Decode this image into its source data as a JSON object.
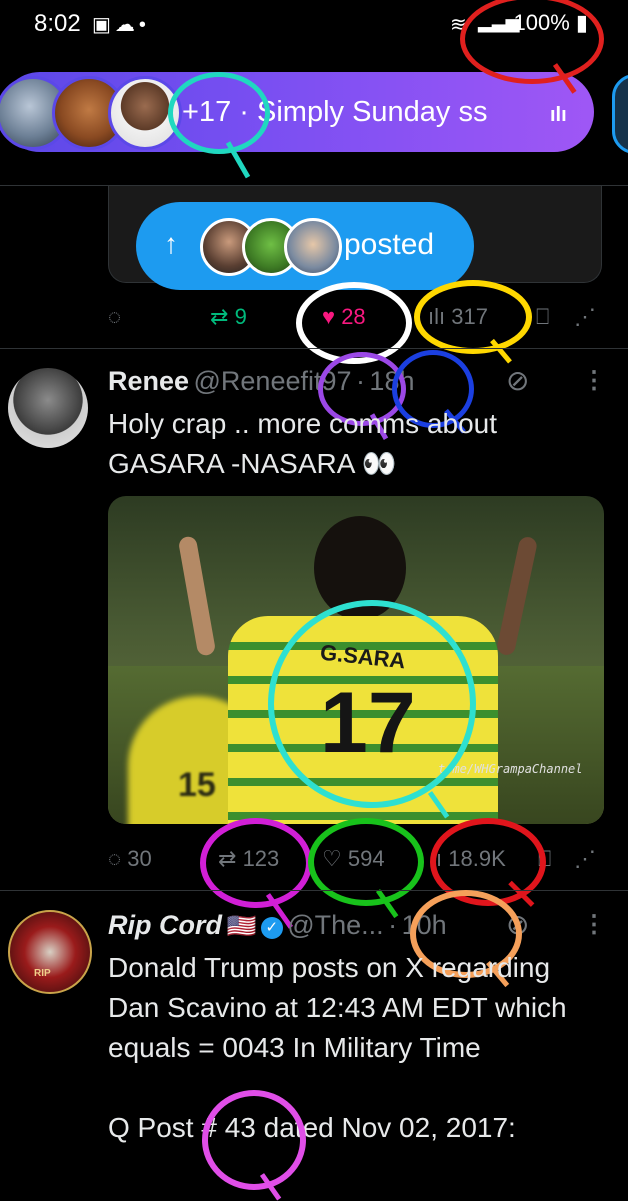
{
  "status_bar": {
    "time": "8:02",
    "battery": "100%"
  },
  "space": {
    "extra_count": "+17",
    "separator": "·",
    "title": "Simply Sunday ss"
  },
  "posted_pill": {
    "label": "posted"
  },
  "tweet1_actions": {
    "reposts": "9",
    "likes": "28",
    "views": "317"
  },
  "tweet2": {
    "name": "Renee",
    "handle": "@Reneefit97",
    "dot": "·",
    "time": "18h",
    "body_line1": "Holy crap .. more comms about",
    "body_line2": "GASARA -NASARA 👀",
    "jersey_name": "G.SARA",
    "jersey_number": "17",
    "second_player_number": "15",
    "watermark": "t.me/WHGrampaChannel",
    "actions": {
      "replies": "30",
      "reposts": "123",
      "likes": "594",
      "views": "18.9K"
    }
  },
  "tweet3": {
    "name": "Rip Cord",
    "flag": "🇺🇸",
    "handle": "@The...",
    "dot": "·",
    "time": "10h",
    "avatar_text": "RIP",
    "body_line1": "Donald Trump posts on X regarding",
    "body_line2": "Dan Scavino at 12:43 AM EDT which",
    "body_line3": "equals = 0043 In Military Time",
    "body_line4": "Q Post # 43 dated Nov 02, 2017:"
  },
  "colors": {
    "accent_blue": "#1d9bf0",
    "like_pink": "#f91880",
    "repost_green": "#00ba7c",
    "space_purple": "#7a4ff2"
  },
  "icons": [
    "photo-icon",
    "cloud-icon",
    "wifi-icon",
    "signal-icon",
    "battery-icon",
    "audio-icon",
    "reply-icon",
    "repost-icon",
    "heart-icon",
    "views-icon",
    "bookmark-icon",
    "share-icon",
    "grok-icon",
    "more-icon",
    "verified-icon"
  ]
}
